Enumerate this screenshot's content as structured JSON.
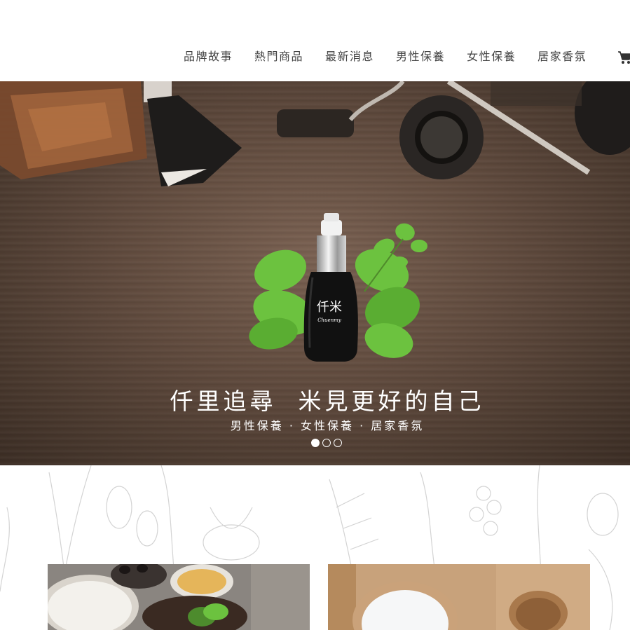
{
  "nav": {
    "items": [
      {
        "label": "品牌故事"
      },
      {
        "label": "熱門商品"
      },
      {
        "label": "最新消息"
      },
      {
        "label": "男性保養"
      },
      {
        "label": "女性保養"
      },
      {
        "label": "居家香氛"
      }
    ],
    "cart_icon": "shopping-cart-icon"
  },
  "hero": {
    "title": "仟里追尋  米見更好的自己",
    "subtitle": "男性保養 · 女性保養 · 居家香氛",
    "logo_text": "仟米",
    "logo_subtext": "Chuenmy",
    "slides_total": 3,
    "active_slide": 1
  },
  "colors": {
    "nav_text": "#444444",
    "hero_wood": "#5f4a3d",
    "hero_text": "#ffffff",
    "mint": "#6cc23f"
  }
}
